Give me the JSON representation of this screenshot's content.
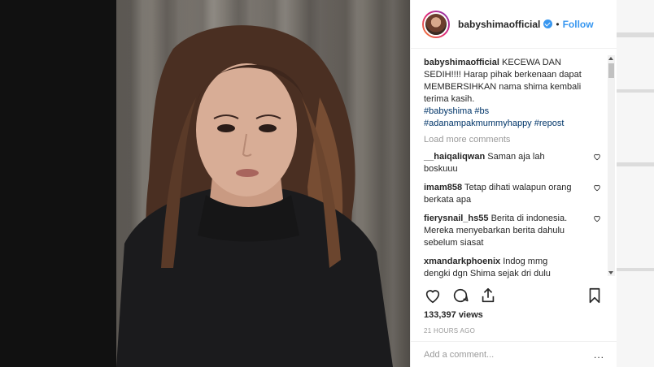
{
  "post": {
    "username": "babyshimaofficial",
    "dot": "•",
    "follow_label": "Follow",
    "caption_user": "babyshimaofficial",
    "caption_text": "KECEWA DAN SEDIH!!!! Harap pihak berkenaan dapat MEMBERSIHKAN nama shima kembali terima kasih.",
    "hashtags_line1": "#babyshima #bs",
    "hashtags_line2": "#adanampakmummyhappy #repost",
    "load_more": "Load more comments",
    "comments": [
      {
        "user": "__haiqaliqwan",
        "text": "Saman aja lah boskuuu"
      },
      {
        "user": "imam858",
        "text": "Tetap dihati walapun orang berkata apa"
      },
      {
        "user": "fierysnail_hs55",
        "text": "Berita di indonesia. Mereka menyebarkan berita dahulu sebelum siasat"
      },
      {
        "user": "xmandarkphoenix",
        "text": "Indog mmg dengki dgn Shima sejak dri dulu lagi...biasalah indog mmg sampah ..sometimes aq prgi Sana mmg sampah merata2 tempat Kotor nk mmpos!! so Shima better u carefully dgn indog2 dorang"
      }
    ],
    "views": "133,397 views",
    "time": "21 HOURS AGO",
    "add_comment_placeholder": "Add a comment...",
    "more_icon": "..."
  },
  "colors": {
    "accent": "#3897f0",
    "hashtag": "#003569",
    "muted": "#999999"
  }
}
